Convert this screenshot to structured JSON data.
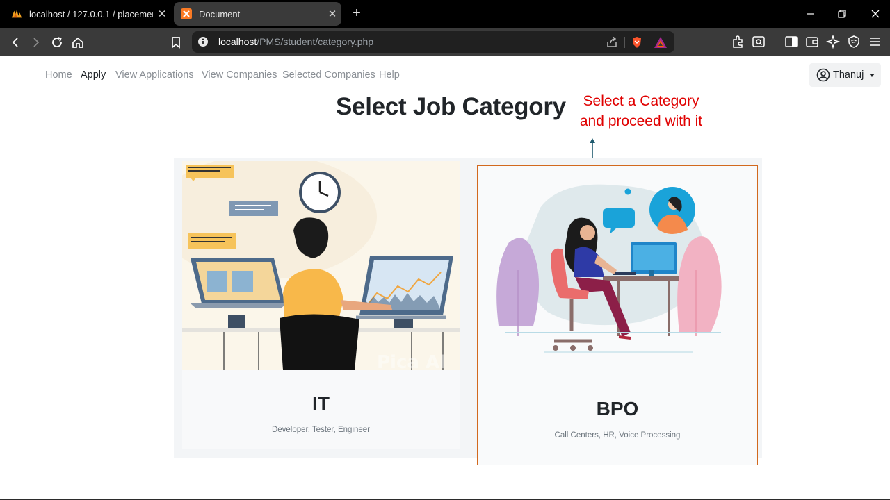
{
  "browser": {
    "tabs": [
      {
        "title": "localhost / 127.0.0.1 / placement",
        "icon": "phpmyadmin-icon",
        "active": false
      },
      {
        "title": "Document",
        "icon": "xampp-icon",
        "active": true
      }
    ],
    "url": {
      "host": "localhost",
      "path": "/PMS/student/category.php"
    }
  },
  "nav": {
    "links": [
      "Home",
      "Apply",
      "View Applications",
      "View Companies",
      "Selected Companies",
      "Help"
    ],
    "active": "Apply",
    "user": "Thanuj"
  },
  "page": {
    "title": "Select Job Category"
  },
  "annotation": {
    "line1": "Select a Category",
    "line2": "and proceed with it",
    "color": "#e00000"
  },
  "categories": [
    {
      "name": "IT",
      "description": "Developer, Tester, Engineer"
    },
    {
      "name": "BPO",
      "description": "Call Centers, HR, Voice Processing"
    }
  ],
  "colors": {
    "highlight_border": "#d2691e",
    "accent_blue": "#1f5a6e"
  }
}
